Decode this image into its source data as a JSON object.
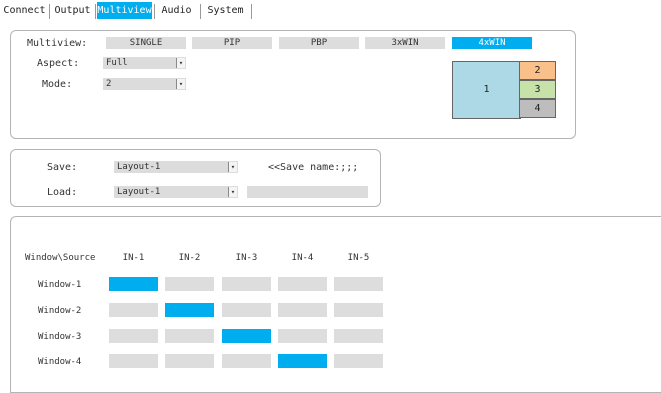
{
  "tabs": [
    {
      "label": "Connect",
      "active": false
    },
    {
      "label": "Output",
      "active": false
    },
    {
      "label": "Multiview",
      "active": true
    },
    {
      "label": "Audio",
      "active": false
    },
    {
      "label": "System",
      "active": false
    }
  ],
  "multiview": {
    "label": "Multiview:",
    "modes": [
      "SINGLE",
      "PIP",
      "PBP",
      "3xWIN",
      "4xWIN"
    ],
    "selected_mode": "4xWIN",
    "aspect_label": "Aspect:",
    "aspect_value": "Full",
    "mode_label": "Mode:",
    "mode_value": "2",
    "diagram": {
      "windows": [
        "1",
        "2",
        "3",
        "4"
      ],
      "colors": {
        "main": "#add8e6",
        "w2": "#f9c08a",
        "w3": "#c6e2a8",
        "w4": "#bdbdbd"
      }
    }
  },
  "layout": {
    "save_label": "Save:",
    "save_value": "Layout-1",
    "save_name_hint": "<<Save name:;;;",
    "load_label": "Load:",
    "load_value": "Layout-1"
  },
  "routing": {
    "corner_label": "Window\\Source",
    "sources": [
      "IN-1",
      "IN-2",
      "IN-3",
      "IN-4",
      "IN-5"
    ],
    "windows": [
      {
        "label": "Window-1",
        "selected": 0
      },
      {
        "label": "Window-2",
        "selected": 1
      },
      {
        "label": "Window-3",
        "selected": 2
      },
      {
        "label": "Window-4",
        "selected": 3
      }
    ]
  },
  "colors": {
    "accent": "#00aeef",
    "inactive": "#dddddd",
    "border": "#b4b4b4"
  }
}
